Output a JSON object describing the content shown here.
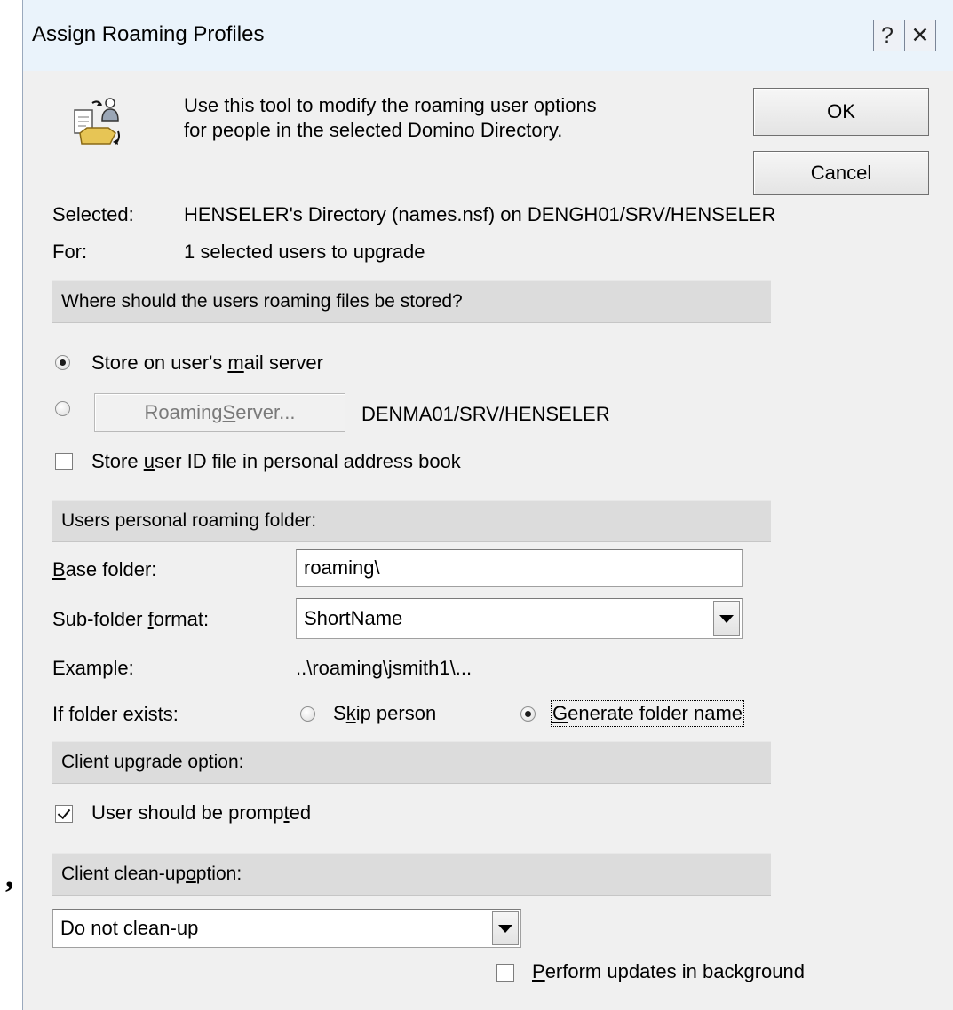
{
  "window": {
    "title": "Assign Roaming Profiles",
    "help_icon": "?",
    "close_icon": "✕"
  },
  "intro": {
    "line1": "Use this tool to modify the roaming user options",
    "line2": "for people in the selected Domino Directory.",
    "icon": "roaming-users-icon"
  },
  "buttons": {
    "ok": "OK",
    "cancel": "Cancel"
  },
  "info": {
    "selected_label": "Selected:",
    "selected_value": "HENSELER's Directory (names.nsf) on DENGH01/SRV/HENSELER",
    "for_label": "For:",
    "for_value": "1 selected users to upgrade"
  },
  "storage": {
    "header": "Where should the users roaming files be stored?",
    "option_mail_server": {
      "pre": "Store on user's ",
      "accel": "m",
      "post": "ail server",
      "selected": true
    },
    "option_roaming_server": {
      "button": {
        "pre": "Roaming ",
        "accel": "S",
        "post": "erver..."
      },
      "value": "DENMA01/SRV/HENSELER",
      "selected": false
    },
    "store_id": {
      "pre": "Store ",
      "accel": "u",
      "post": "ser ID file in personal address book",
      "checked": false
    }
  },
  "folder": {
    "header": "Users personal roaming folder:",
    "base_label": {
      "pre": "",
      "accel": "B",
      "post": "ase folder:"
    },
    "base_value": "roaming\\",
    "subfolder_label": {
      "pre": "Sub-folder ",
      "accel": "f",
      "post": "ormat:"
    },
    "subfolder_value": "ShortName",
    "example_label": "Example:",
    "example_value": "..\\roaming\\jsmith1\\...",
    "exists_label": "If folder exists:",
    "skip": {
      "pre": "S",
      "accel": "k",
      "post": "ip person",
      "selected": false
    },
    "generate": {
      "pre": "",
      "accel": "G",
      "post": "enerate folder name",
      "selected": true
    }
  },
  "upgrade": {
    "header": "Client upgrade option:",
    "prompted": {
      "pre": "User should be promp",
      "accel": "t",
      "post": "ed",
      "checked": true
    }
  },
  "cleanup": {
    "header": {
      "pre": "Client clean-up ",
      "accel": "o",
      "post": "ption:"
    },
    "value": "Do not clean-up",
    "background": {
      "pre": "",
      "accel": "P",
      "post": "erform updates in background",
      "checked": false
    }
  },
  "stray_mark": ","
}
